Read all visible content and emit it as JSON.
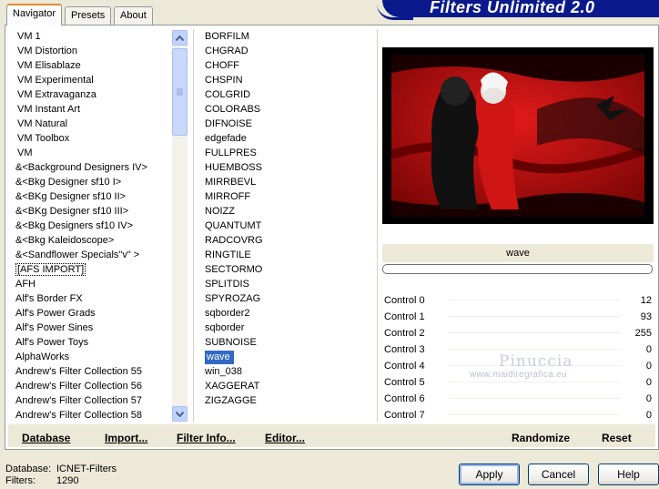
{
  "tabs": [
    {
      "label": "Navigator"
    },
    {
      "label": "Presets"
    },
    {
      "label": "About"
    }
  ],
  "app_title": "Filters Unlimited 2.0",
  "categories": [
    "VM 1",
    "VM Distortion",
    "VM Elisablaze",
    "VM Experimental",
    "VM Extravaganza",
    "VM Instant Art",
    "VM Natural",
    "VM Toolbox",
    "VM",
    "&<Background Designers IV>",
    "&<Bkg Designer sf10 I>",
    "&<BKg Designer sf10 II>",
    "&<BKg Designer sf10 III>",
    "&<Bkg Designers sf10 IV>",
    "&<Bkg Kaleidoscope>",
    "&<Sandflower Specials\"v\" >",
    "[AFS IMPORT]",
    "AFH",
    "Alf's Border FX",
    "Alf's Power Grads",
    "Alf's Power Sines",
    "Alf's Power Toys",
    "AlphaWorks",
    "Andrew's Filter Collection 55",
    "Andrew's Filter Collection 56",
    "Andrew's Filter Collection 57",
    "Andrew's Filter Collection 58"
  ],
  "selected_category": "[AFS IMPORT]",
  "filters": [
    "BORFILM",
    "CHGRAD",
    "CHOFF",
    "CHSPIN",
    "COLGRID",
    "COLORABS",
    "DIFNOISE",
    "edgefade",
    "FULLPRES",
    "HUEMBOSS",
    "MIRRBEVL",
    "MIRROFF",
    "NOIZZ",
    "QUANTUMT",
    "RADCOVRG",
    "RINGTILE",
    "SECTORMO",
    "SPLITDIS",
    "SPYROZAG",
    "sqborder2",
    "sqborder",
    "SUBNOISE",
    "wave",
    "win_038",
    "XAGGERAT",
    "ZIGZAGGE"
  ],
  "selected_filter": "wave",
  "filter_name": "wave",
  "controls": [
    {
      "label": "Control 0",
      "value": "12"
    },
    {
      "label": "Control 1",
      "value": "93"
    },
    {
      "label": "Control 2",
      "value": "255"
    },
    {
      "label": "Control 3",
      "value": "0"
    },
    {
      "label": "Control 4",
      "value": "0"
    },
    {
      "label": "Control 5",
      "value": "0"
    },
    {
      "label": "Control 6",
      "value": "0"
    },
    {
      "label": "Control 7",
      "value": "0"
    }
  ],
  "watermark": {
    "title": "Pinuccia",
    "url": "www.maidiregrafica.eu"
  },
  "bottom_links": {
    "database": "Database",
    "import": "Import...",
    "filter_info": "Filter Info...",
    "editor": "Editor...",
    "randomize": "Randomize",
    "reset": "Reset"
  },
  "status": {
    "database_label": "Database:",
    "database_value": "ICNET-Filters",
    "filters_label": "Filters:",
    "filters_value": "1290"
  },
  "buttons": {
    "apply": "Apply",
    "cancel": "Cancel",
    "help": "Help"
  },
  "colors": {
    "selection": "#316ac5",
    "banner": "#0a1a8c",
    "preview_red": "#c21010"
  }
}
